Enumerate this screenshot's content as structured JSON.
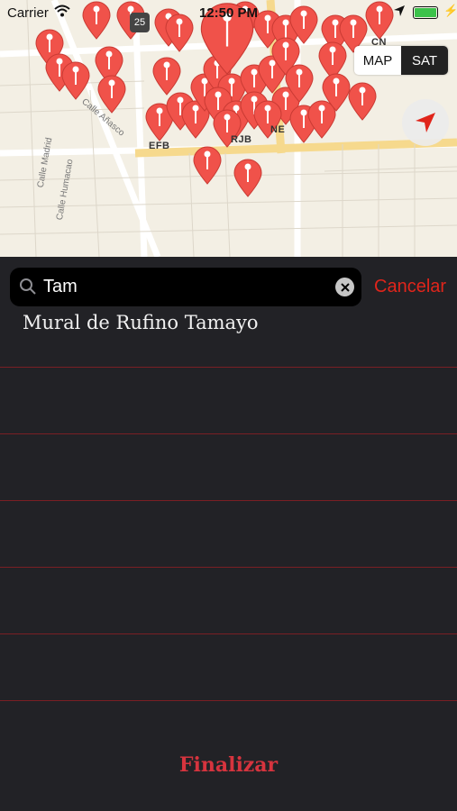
{
  "status_bar": {
    "carrier": "Carrier",
    "time": "12:50 PM"
  },
  "map": {
    "segment_map": "MAP",
    "segment_sat": "SAT",
    "labels": [
      "CN",
      "EFB",
      "RJB",
      "NE"
    ],
    "streets": [
      "Calle Añasco",
      "Calle Madrid",
      "Calle Humacao"
    ],
    "route_shield": "25",
    "pin_color": "#f0524a"
  },
  "search": {
    "value": "Tam",
    "cancel_label": "Cancelar"
  },
  "results": [
    {
      "label": "Mural de Rufino Tamayo"
    }
  ],
  "footer": {
    "done_label": "Finalizar"
  },
  "colors": {
    "accent": "#e0251b",
    "separator": "#7a1f24",
    "background": "#222226"
  }
}
